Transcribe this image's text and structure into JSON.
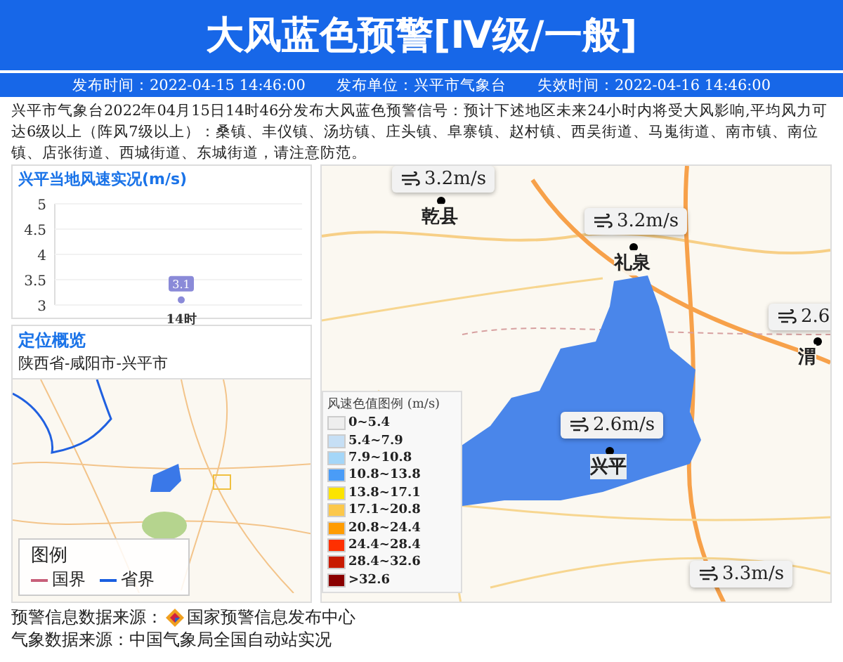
{
  "header": {
    "title": "大风蓝色预警[Ⅳ级/一般]",
    "meta": [
      "发布时间：2022-04-15 14:46:00",
      "发布单位：兴平市气象台",
      "失效时间：2022-04-16 14:46:00"
    ]
  },
  "description": "兴平市气象台2022年04月15日14时46分发布大风蓝色预警信号：预计下述地区未来24小时内将受大风影响,平均风力可达6级以上（阵风7级以上）：桑镇、丰仪镇、汤坊镇、庄头镇、阜寨镇、赵村镇、西吴街道、马嵬街道、南市镇、南位镇、店张街道、西城街道、东城街道，请注意防范。",
  "wind_panel": {
    "title": "兴平当地风速实况(m/s)",
    "chart_data": {
      "type": "line",
      "categories": [
        "14时"
      ],
      "series": [
        {
          "color": "#8a8ad8",
          "marker": true,
          "values": [
            3.1
          ]
        }
      ],
      "ylim": [
        3,
        5
      ],
      "yticks": [
        3,
        3.5,
        4,
        4.5,
        5
      ],
      "grid": true,
      "data_labels": true
    }
  },
  "location_panel": {
    "title": "定位概览",
    "region": "陕西省-咸阳市-兴平市",
    "map_legend": {
      "title": "图例",
      "items": [
        {
          "label": "国界",
          "color": "#c8607a"
        },
        {
          "label": "省界",
          "color": "#1a5fe0"
        }
      ]
    }
  },
  "map": {
    "stations": [
      {
        "reading": "3.2m/s",
        "name": "乾县"
      },
      {
        "reading": "3.2m/s",
        "name": "礼泉"
      },
      {
        "reading": "2.6",
        "name": "渭"
      },
      {
        "reading": "2.6m/s",
        "name": "兴平"
      },
      {
        "reading": "3.3m/s"
      }
    ],
    "legend": {
      "title": "风速色值图例 (m/s)",
      "items": [
        {
          "label": "0~5.4",
          "color": "#eeeeee"
        },
        {
          "label": "5.4~7.9",
          "color": "#c6dff5"
        },
        {
          "label": "7.9~10.8",
          "color": "#a4d6f8"
        },
        {
          "label": "10.8~13.8",
          "color": "#4a9cf7"
        },
        {
          "label": "13.8~17.1",
          "color": "#fce400"
        },
        {
          "label": "17.1~20.8",
          "color": "#fcc84a"
        },
        {
          "label": "20.8~24.4",
          "color": "#ff9c00"
        },
        {
          "label": "24.4~28.4",
          "color": "#ff3000"
        },
        {
          "label": "28.4~32.6",
          "color": "#c81a00"
        },
        {
          "label": ">32.6",
          "color": "#8a0000"
        }
      ]
    }
  },
  "footer": {
    "source_label": "预警信息数据来源：",
    "source": "国家预警信息发布中心",
    "weather_source": "气象数据来源：中国气象局全国自动站实况"
  }
}
